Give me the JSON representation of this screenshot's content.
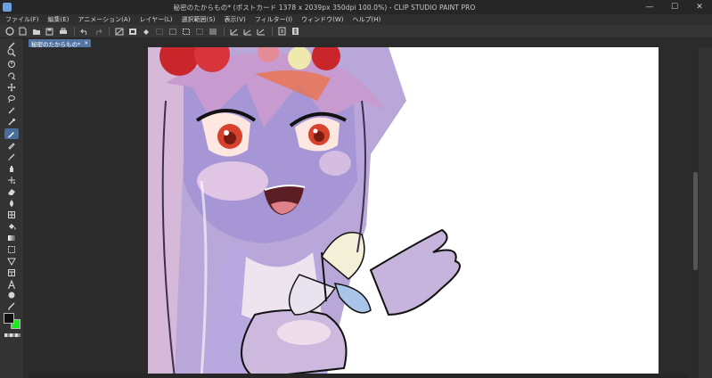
{
  "window": {
    "title": "秘密のたからもの* (ポストカード 1378 x 2039px 350dpi 100.0%) - CLIP STUDIO PAINT PRO",
    "minimize": "—",
    "maximize": "☐",
    "close": "✕"
  },
  "menu": [
    {
      "label": "ファイル(F)"
    },
    {
      "label": "編集(E)"
    },
    {
      "label": "アニメーション(A)"
    },
    {
      "label": "レイヤー(L)"
    },
    {
      "label": "選択範囲(S)"
    },
    {
      "label": "表示(V)"
    },
    {
      "label": "フィルター(I)"
    },
    {
      "label": "ウィンドウ(W)"
    },
    {
      "label": "ヘルプ(H)"
    }
  ],
  "document_tab": {
    "label": "秘密のたからもの*",
    "close": "×"
  },
  "colors": {
    "main": "#111111",
    "sub": "#1ee81e",
    "active_tool": "#4a6e9a"
  }
}
